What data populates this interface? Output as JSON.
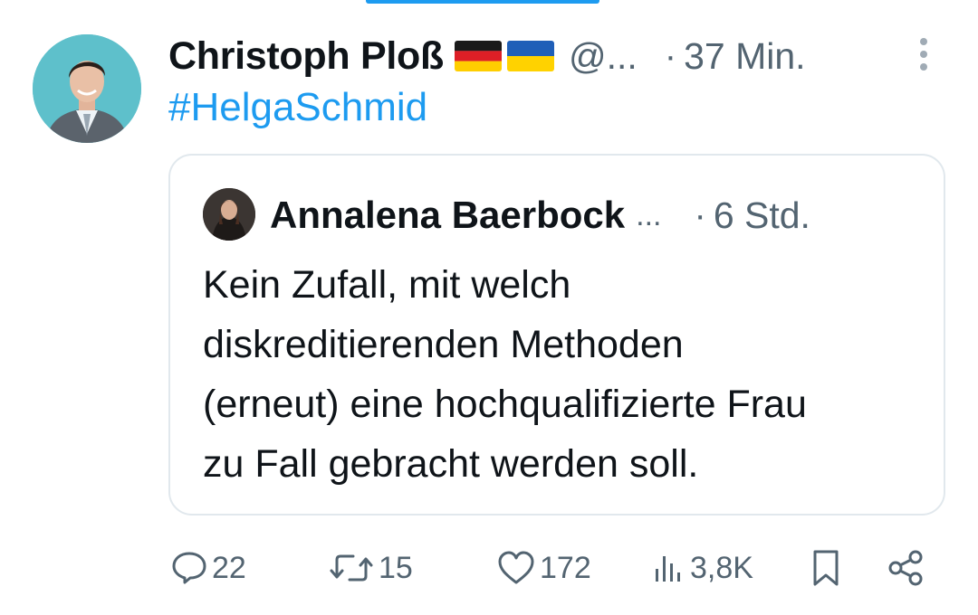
{
  "tweet": {
    "author_name": "Christoph Ploß",
    "flags": [
      "germany-flag",
      "ukraine-flag"
    ],
    "handle": "@...",
    "dot": "·",
    "time": "37 Min.",
    "text": "#HelgaSchmid"
  },
  "quoted_tweet": {
    "author_name": "Annalena Baerbock",
    "ellipsis": "...",
    "dot": "·",
    "time": "6 Std.",
    "lines": [
      "Kein Zufall, mit welch",
      "diskreditierenden Methoden",
      "(erneut) eine hochqualifizierte Frau",
      "zu Fall gebracht werden soll."
    ]
  },
  "actions": {
    "replies": "22",
    "retweets": "15",
    "likes": "172",
    "views": "3,8K"
  },
  "colors": {
    "accent": "#1d9bf0",
    "muted": "#536471",
    "text": "#0f1419",
    "border": "#e1e8ed"
  }
}
